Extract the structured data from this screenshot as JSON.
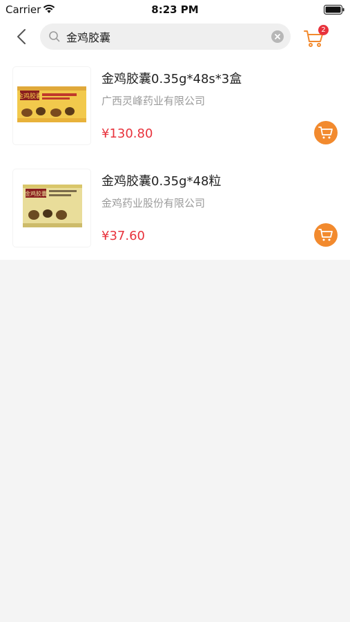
{
  "status_bar": {
    "carrier": "Carrier",
    "time": "8:23 PM"
  },
  "search": {
    "value": "金鸡胶囊"
  },
  "cart": {
    "badge_count": "2"
  },
  "colors": {
    "price": "#e8323c",
    "accent": "#f28a2e",
    "badge": "#e8323c"
  },
  "products": [
    {
      "name": "金鸡胶囊0.35g*48s*3盒",
      "manufacturer": "广西灵峰药业有限公司",
      "price": "¥130.80",
      "box_title": "金鸡胶囊"
    },
    {
      "name": "金鸡胶囊0.35g*48粒",
      "manufacturer": "金鸡药业股份有限公司",
      "price": "¥37.60",
      "box_title": "金鸡胶囊"
    }
  ]
}
